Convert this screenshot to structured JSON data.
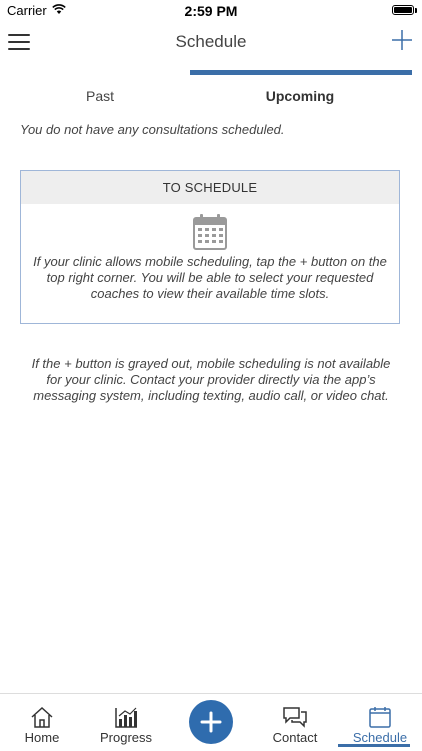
{
  "status_bar": {
    "carrier": "Carrier",
    "time": "2:59 PM"
  },
  "nav": {
    "title": "Schedule"
  },
  "tabs": [
    {
      "label": "Past",
      "active": false
    },
    {
      "label": "Upcoming",
      "active": true
    }
  ],
  "empty_message": "You do not have any consultations scheduled.",
  "card": {
    "header": "TO SCHEDULE",
    "body": "If your clinic allows mobile scheduling, tap the + button on the top right corner. You will be able to select your requested coaches to view their available time slots."
  },
  "footer_note": "If the + button is grayed out, mobile scheduling is not available for your clinic. Contact your provider directly via the app’s messaging system, including texting, audio call, or video chat.",
  "tab_bar": {
    "items": [
      {
        "label": "Home",
        "icon": "home-icon"
      },
      {
        "label": "Progress",
        "icon": "chart-icon"
      },
      {
        "label": "",
        "icon": "add-icon"
      },
      {
        "label": "Contact",
        "icon": "chat-icon"
      },
      {
        "label": "Schedule",
        "icon": "calendar-icon"
      }
    ]
  },
  "colors": {
    "accent": "#3b6ea8",
    "add_button": "#2f6cae",
    "card_border": "#9fb6d8"
  }
}
